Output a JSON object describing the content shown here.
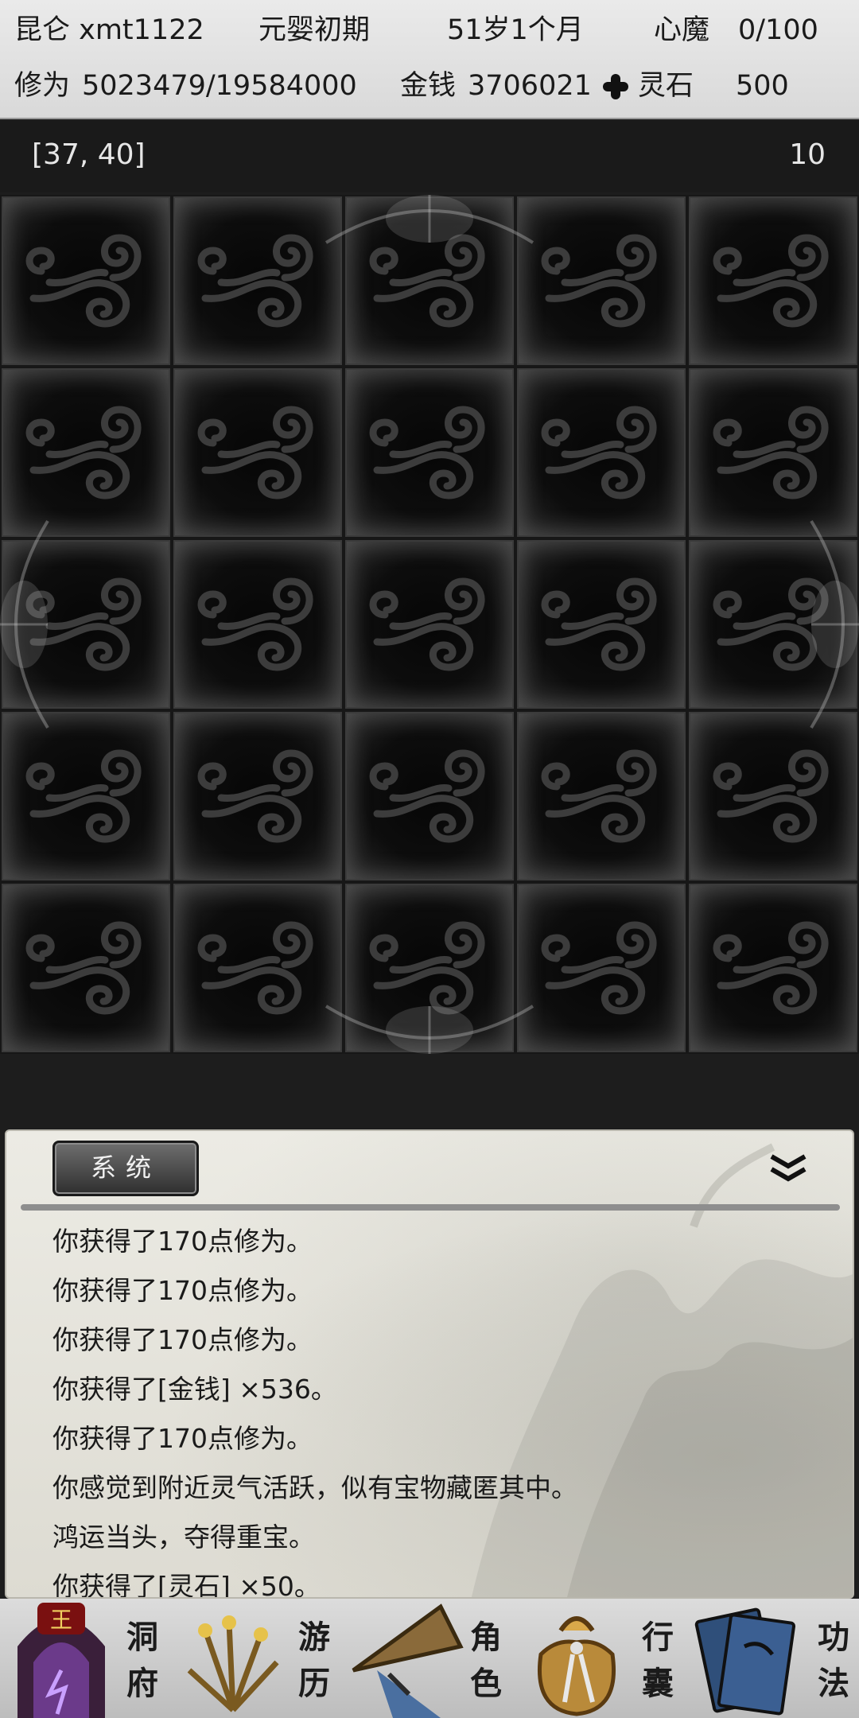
{
  "status": {
    "name": "昆仑 xmt1122",
    "realm": "元婴初期",
    "age": "51岁1个月",
    "demon_label": "心魔",
    "demon_value": "0/100",
    "cultivation_label": "修为",
    "cultivation_value": "5023479/19584000",
    "money_label": "金钱",
    "money_value": "3706021",
    "stone_label": "灵石",
    "stone_value": "500"
  },
  "map": {
    "coords": "[37, 40]",
    "count": "10",
    "rows": 5,
    "cols": 5
  },
  "log": {
    "tab_label": "系统",
    "lines": [
      "你获得了170点修为。",
      "你获得了170点修为。",
      "你获得了170点修为。",
      "你获得了[金钱] ×536。",
      "你获得了170点修为。",
      "你感觉到附近灵气活跃，似有宝物藏匿其中。",
      "鸿运当头，夺得重宝。",
      "你获得了[灵石] ×50。"
    ]
  },
  "nav": {
    "items": [
      {
        "id": "cave",
        "line1": "洞",
        "line2": "府",
        "icon": "cave-icon",
        "badge": "王"
      },
      {
        "id": "travel",
        "line1": "游",
        "line2": "历",
        "icon": "grass-icon"
      },
      {
        "id": "character",
        "line1": "角",
        "line2": "色",
        "icon": "hat-icon"
      },
      {
        "id": "bag",
        "line1": "行",
        "line2": "囊",
        "icon": "bag-icon"
      },
      {
        "id": "skills",
        "line1": "功",
        "line2": "法",
        "icon": "book-icon"
      }
    ]
  },
  "colors": {
    "header_bg": "#e2e2e2",
    "map_bg": "#171717",
    "log_bg": "#e6e5dd",
    "tab_bg": "#3c3c3c"
  }
}
